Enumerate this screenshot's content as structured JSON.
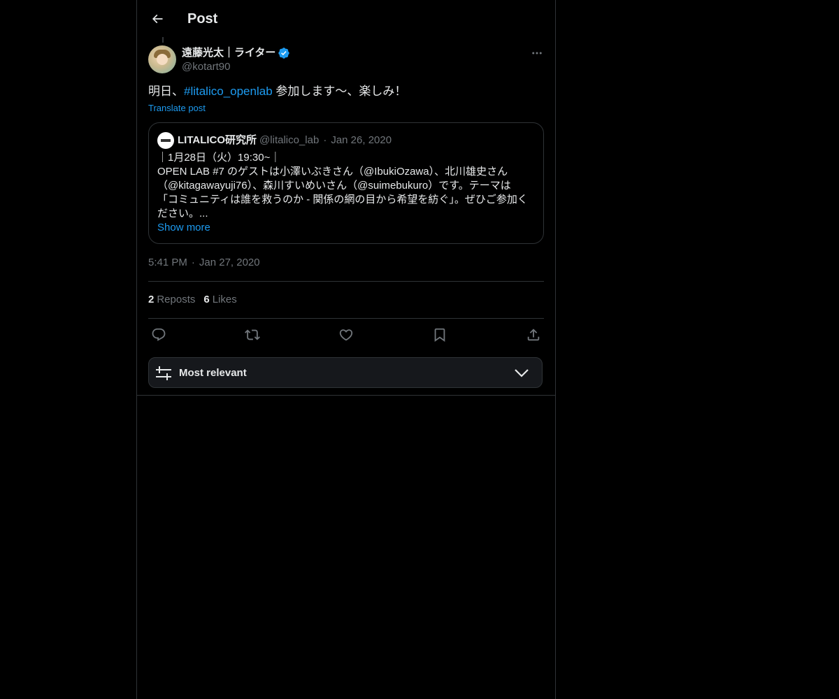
{
  "header": {
    "title": "Post"
  },
  "post": {
    "author_name": "遠藤光太｜ライター",
    "author_handle": "@kotart90",
    "text_before": "明日、",
    "hashtag": "#litalico_openlab",
    "text_after": " 参加します〜、楽しみ！",
    "translate_label": "Translate post",
    "time": "5:41 PM",
    "date": "Jan 27, 2020",
    "separator": "·"
  },
  "quote": {
    "name": "LITALICO研究所",
    "handle": "@litalico_lab",
    "separator": "·",
    "date": "Jan 26, 2020",
    "lines": [
      "｜1月28日（火）19:30~｜",
      "OPEN LAB #7 のゲストは小澤いぶきさん（@IbukiOzawa）、北川雄史さん",
      "（@kitagawayuji76）、森川すいめいさん（@suimebukuro）です。テーマは",
      "「コミュニティは誰を救うのか - 関係の網の目から希望を紡ぐ」。ぜひご参加く",
      "ださい。..."
    ],
    "show_more": "Show more"
  },
  "stats": {
    "reposts_count": "2",
    "reposts_label": "Reposts",
    "likes_count": "6",
    "likes_label": "Likes"
  },
  "actions": {
    "icons": [
      "reply-icon",
      "repost-icon",
      "like-icon",
      "bookmark-icon",
      "share-icon"
    ]
  },
  "sort": {
    "label": "Most relevant"
  },
  "colors": {
    "background": "#000000",
    "accent": "#1d9bf0",
    "text": "#e7e9ea",
    "muted": "#71767b",
    "border": "#2f3336"
  }
}
